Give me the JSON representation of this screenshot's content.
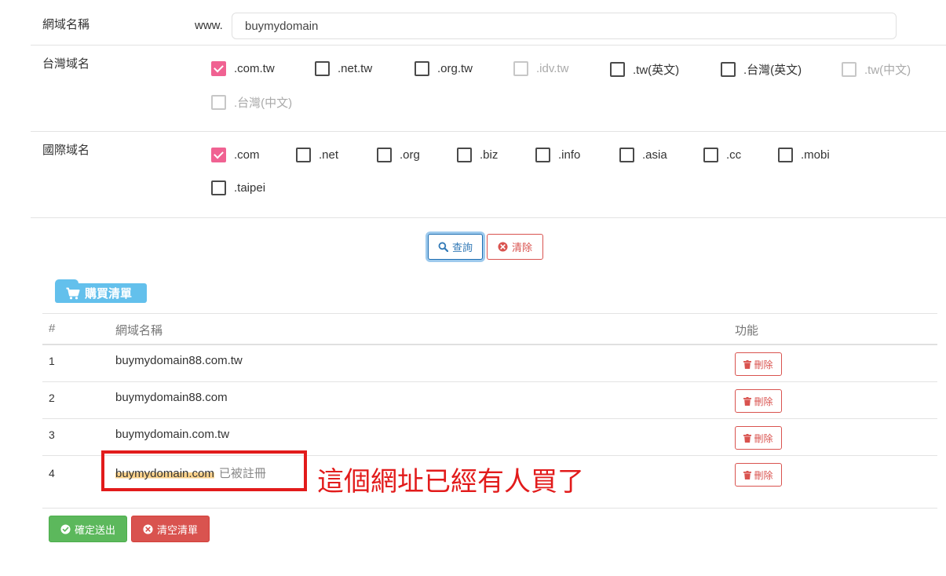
{
  "domain_row": {
    "label": "網域名稱",
    "prefix": "www.",
    "value": "buymydomain"
  },
  "tw_row": {
    "label": "台灣域名",
    "options": [
      {
        "label": ".com.tw",
        "checked": true,
        "disabled": false
      },
      {
        "label": ".net.tw",
        "checked": false,
        "disabled": false
      },
      {
        "label": ".org.tw",
        "checked": false,
        "disabled": false
      },
      {
        "label": ".idv.tw",
        "checked": false,
        "disabled": true
      },
      {
        "label": ".tw(英文)",
        "checked": false,
        "disabled": false
      },
      {
        "label": ".台灣(英文)",
        "checked": false,
        "disabled": false
      },
      {
        "label": ".tw(中文)",
        "checked": false,
        "disabled": true
      },
      {
        "label": ".台灣(中文)",
        "checked": false,
        "disabled": true
      }
    ]
  },
  "intl_row": {
    "label": "國際域名",
    "options": [
      {
        "label": ".com",
        "checked": true,
        "disabled": false
      },
      {
        "label": ".net",
        "checked": false,
        "disabled": false
      },
      {
        "label": ".org",
        "checked": false,
        "disabled": false
      },
      {
        "label": ".biz",
        "checked": false,
        "disabled": false
      },
      {
        "label": ".info",
        "checked": false,
        "disabled": false
      },
      {
        "label": ".asia",
        "checked": false,
        "disabled": false
      },
      {
        "label": ".cc",
        "checked": false,
        "disabled": false
      },
      {
        "label": ".mobi",
        "checked": false,
        "disabled": false
      },
      {
        "label": ".taipei",
        "checked": false,
        "disabled": false
      }
    ]
  },
  "actions": {
    "query_label": "查詢",
    "clear_label": "清除"
  },
  "cart": {
    "title": "購買清單",
    "columns": {
      "num": "#",
      "name": "網域名稱",
      "func": "功能"
    },
    "rows": [
      {
        "num": "1",
        "name": "buymydomain88.com.tw",
        "delete_label": "刪除"
      },
      {
        "num": "2",
        "name": "buymydomain88.com",
        "delete_label": "刪除"
      },
      {
        "num": "3",
        "name": "buymydomain.com.tw",
        "delete_label": "刪除"
      },
      {
        "num": "4",
        "name": "buymydomain.com",
        "status": "已被註冊",
        "delete_label": "刪除"
      }
    ],
    "annotation": "這個網址已經有人買了"
  },
  "footer": {
    "submit_label": "確定送出",
    "empty_label": "清空清單"
  },
  "colors": {
    "checked": "#f06292",
    "primary": "#337ab7",
    "danger": "#d9534f",
    "success": "#5cb85c",
    "info": "#63c0ec",
    "annotation": "#e21b1b"
  }
}
